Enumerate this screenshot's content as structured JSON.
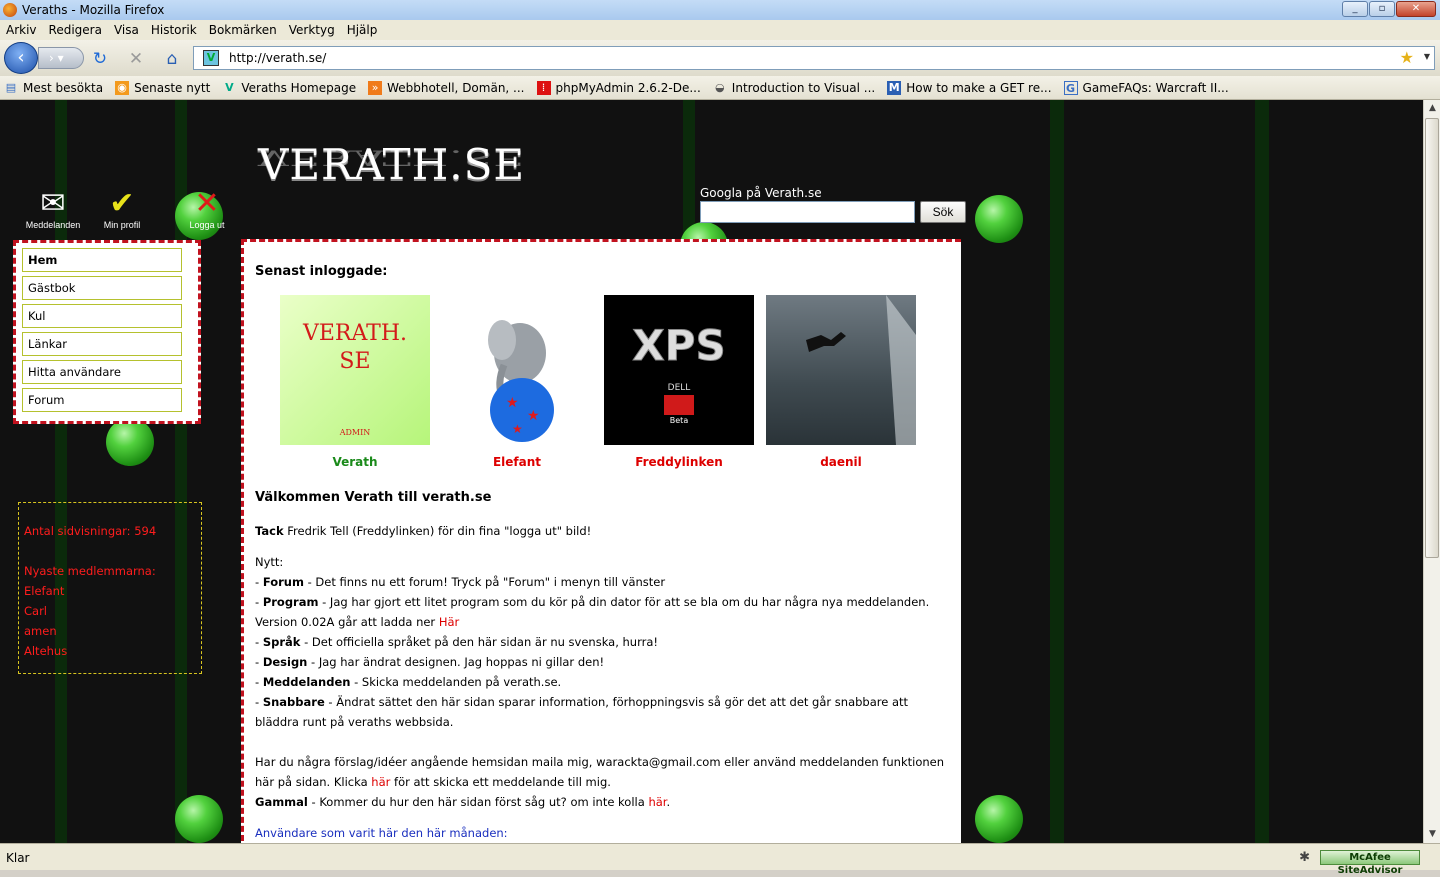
{
  "window": {
    "title": "Veraths - Mozilla Firefox",
    "buttons": [
      "_",
      "▫",
      "✕"
    ]
  },
  "menu": [
    "Arkiv",
    "Redigera",
    "Visa",
    "Historik",
    "Bokmärken",
    "Verktyg",
    "Hjälp"
  ],
  "nav": {
    "url": "http://verath.se/"
  },
  "bookmarks": [
    {
      "label": "Mest besökta",
      "icon": "page-icon"
    },
    {
      "label": "Senaste nytt",
      "icon": "rss-icon"
    },
    {
      "label": "Veraths Homepage",
      "icon": "verath-icon"
    },
    {
      "label": "Webbhotell, Domän, ...",
      "icon": "webhost-icon"
    },
    {
      "label": "phpMyAdmin 2.6.2-De...",
      "icon": "phpmyadmin-icon"
    },
    {
      "label": "Introduction to Visual ...",
      "icon": "globe-icon"
    },
    {
      "label": "How to make a GET re...",
      "icon": "m-icon"
    },
    {
      "label": "GameFAQs: Warcraft II...",
      "icon": "gamefaqs-icon"
    }
  ],
  "site": {
    "logo": "VERATH.SE",
    "search_label": "Googla på Verath.se",
    "search_button": "Sök",
    "top_icons": [
      {
        "label": "Meddelanden",
        "icon": "envelope-icon"
      },
      {
        "label": "Min profil",
        "icon": "profile-icon"
      },
      {
        "label": "Logga ut",
        "icon": "logout-icon"
      }
    ],
    "nav_items": [
      "Hem",
      "Gästbok",
      "Kul",
      "Länkar",
      "Hitta användare",
      "Forum"
    ],
    "stats": {
      "views": "Antal sidvisningar: 594",
      "newest_label": "Nyaste medlemmarna:",
      "newest": [
        "Elefant",
        "Carl",
        "amen",
        "Altehus"
      ]
    },
    "latest_heading": "Senast inloggade:",
    "users": [
      {
        "name": "Verath",
        "color": "#1a8a1a",
        "img_text": "VERATH.\nSE",
        "img_sub": "ADMIN"
      },
      {
        "name": "Elefant",
        "color": "#d00"
      },
      {
        "name": "Freddylinken",
        "color": "#d00",
        "img_text": "XPS",
        "img_sub": "Beta"
      },
      {
        "name": "daenil",
        "color": "#d00"
      }
    ],
    "welcome": "Välkommen Verath till verath.se",
    "thanks_bold": "Tack",
    "thanks_text": " Fredrik Tell (Freddylinken) för din fina \"logga ut\" bild!",
    "news_label": "Nytt:",
    "news": [
      {
        "title": "Forum",
        "text": " - Det finns nu ett forum! Tryck på \"Forum\" i menyn till vänster"
      },
      {
        "title": "Program",
        "text": " - Jag har gjort ett litet program som du kör på din dator för att se bla om du har några nya meddelanden."
      },
      {
        "title": "Språk",
        "text": " - Det officiella språket på den här sidan är nu svenska, hurra!"
      },
      {
        "title": "Design",
        "text": " - Jag har ändrat designen. Jag hoppas ni gillar den!"
      },
      {
        "title": "Meddelanden",
        "text": " - Skicka meddelanden på verath.se."
      },
      {
        "title": "Snabbare",
        "text": " - Ändrat sättet den här sidan sparar information, förhoppningsvis så gör det att det går snabbare att bläddra runt på veraths webbsida."
      }
    ],
    "version_text": "Version 0.02A går att ladda ner ",
    "link_har_cap": "Här",
    "link_har": "här",
    "suggest_text_1": "Har du några förslag/idéer angående hemsidan maila mig, warackta@gmail.com eller använd meddelanden funktionen",
    "suggest_text_2": "här på sidan. Klicka ",
    "suggest_text_3": " för att skicka ett meddelande till mig.",
    "old_title": "Gammal",
    "old_text": " - Kommer du hur den här sidan först såg ut? om inte kolla ",
    "month_users": "Användare som varit här den här månaden:"
  },
  "status": {
    "text": "Klar",
    "mcafee": "McAfee SiteAdvisor"
  }
}
